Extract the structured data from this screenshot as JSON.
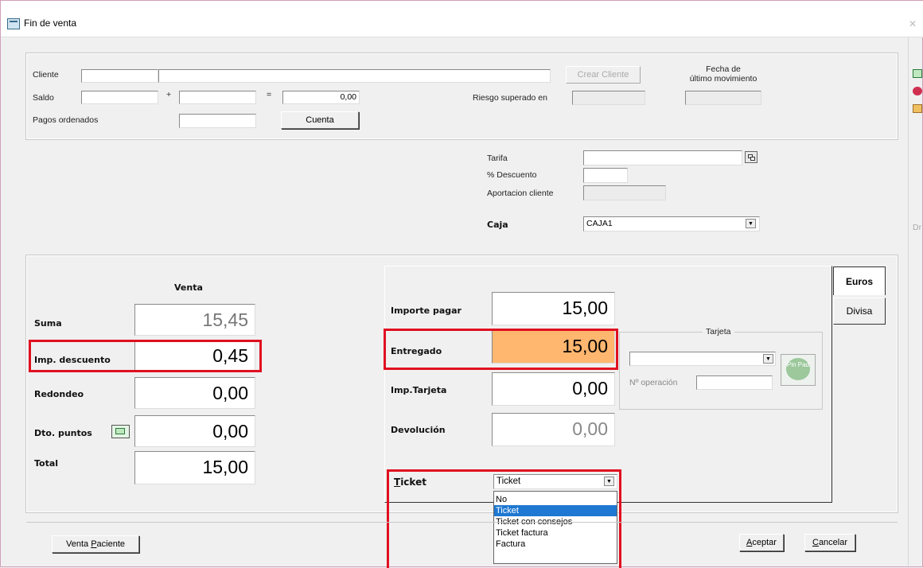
{
  "window": {
    "title": "Fin de venta"
  },
  "client": {
    "cliente_label": "Cliente",
    "saldo_label": "Saldo",
    "saldo_value": "0,00",
    "pagos_label": "Pagos ordenados",
    "cuenta_button": "Cuenta",
    "crear_cliente_button": "Crear Cliente",
    "riesgo_label": "Riesgo superado en",
    "fecha_label_1": "Fecha de",
    "fecha_label_2": "último movimiento"
  },
  "tarifa": {
    "tarifa_label": "Tarifa",
    "descuento_label": "% Descuento",
    "aportacion_label": "Aportacion cliente",
    "caja_label": "Caja",
    "caja_value": "CAJA1"
  },
  "venta": {
    "header": "Venta",
    "suma_label": "Suma",
    "suma_value": "15,45",
    "descuento_label": "Imp. descuento",
    "descuento_value": "0,45",
    "redondeo_label": "Redondeo",
    "redondeo_value": "0,00",
    "puntos_label": "Dto. puntos",
    "puntos_value": "0,00",
    "total_label": "Total",
    "total_value": "15,00"
  },
  "payment": {
    "tab_euros": "Euros",
    "tab_divisa": "Divisa",
    "importe_label": "Importe pagar",
    "importe_value": "15,00",
    "entregado_label": "Entregado",
    "entregado_value": "15,00",
    "tarjeta_label": "Imp.Tarjeta",
    "tarjeta_value": "0,00",
    "devolucion_label": "Devolución",
    "devolucion_value": "0,00",
    "tarjeta_group": "Tarjeta",
    "operacion_label": "Nº operación",
    "pinpad_button": "Pin Pad"
  },
  "ticket": {
    "label_first": "T",
    "label_rest": "icket",
    "selected": "Ticket",
    "options": [
      "No",
      "Ticket",
      "Ticket con consejos",
      "Ticket factura",
      "Factura"
    ]
  },
  "footer": {
    "venta_paciente_pre": "Venta ",
    "venta_paciente_u": "P",
    "venta_paciente_post": "aciente",
    "aceptar_u": "A",
    "aceptar_post": "ceptar",
    "cancelar_u": "C",
    "cancelar_post": "ancelar"
  },
  "side": {
    "label": "Dr"
  },
  "colors": {
    "highlight": "#ffb66e",
    "red_outline": "#e01020",
    "selected_option": "#1f78d1"
  }
}
